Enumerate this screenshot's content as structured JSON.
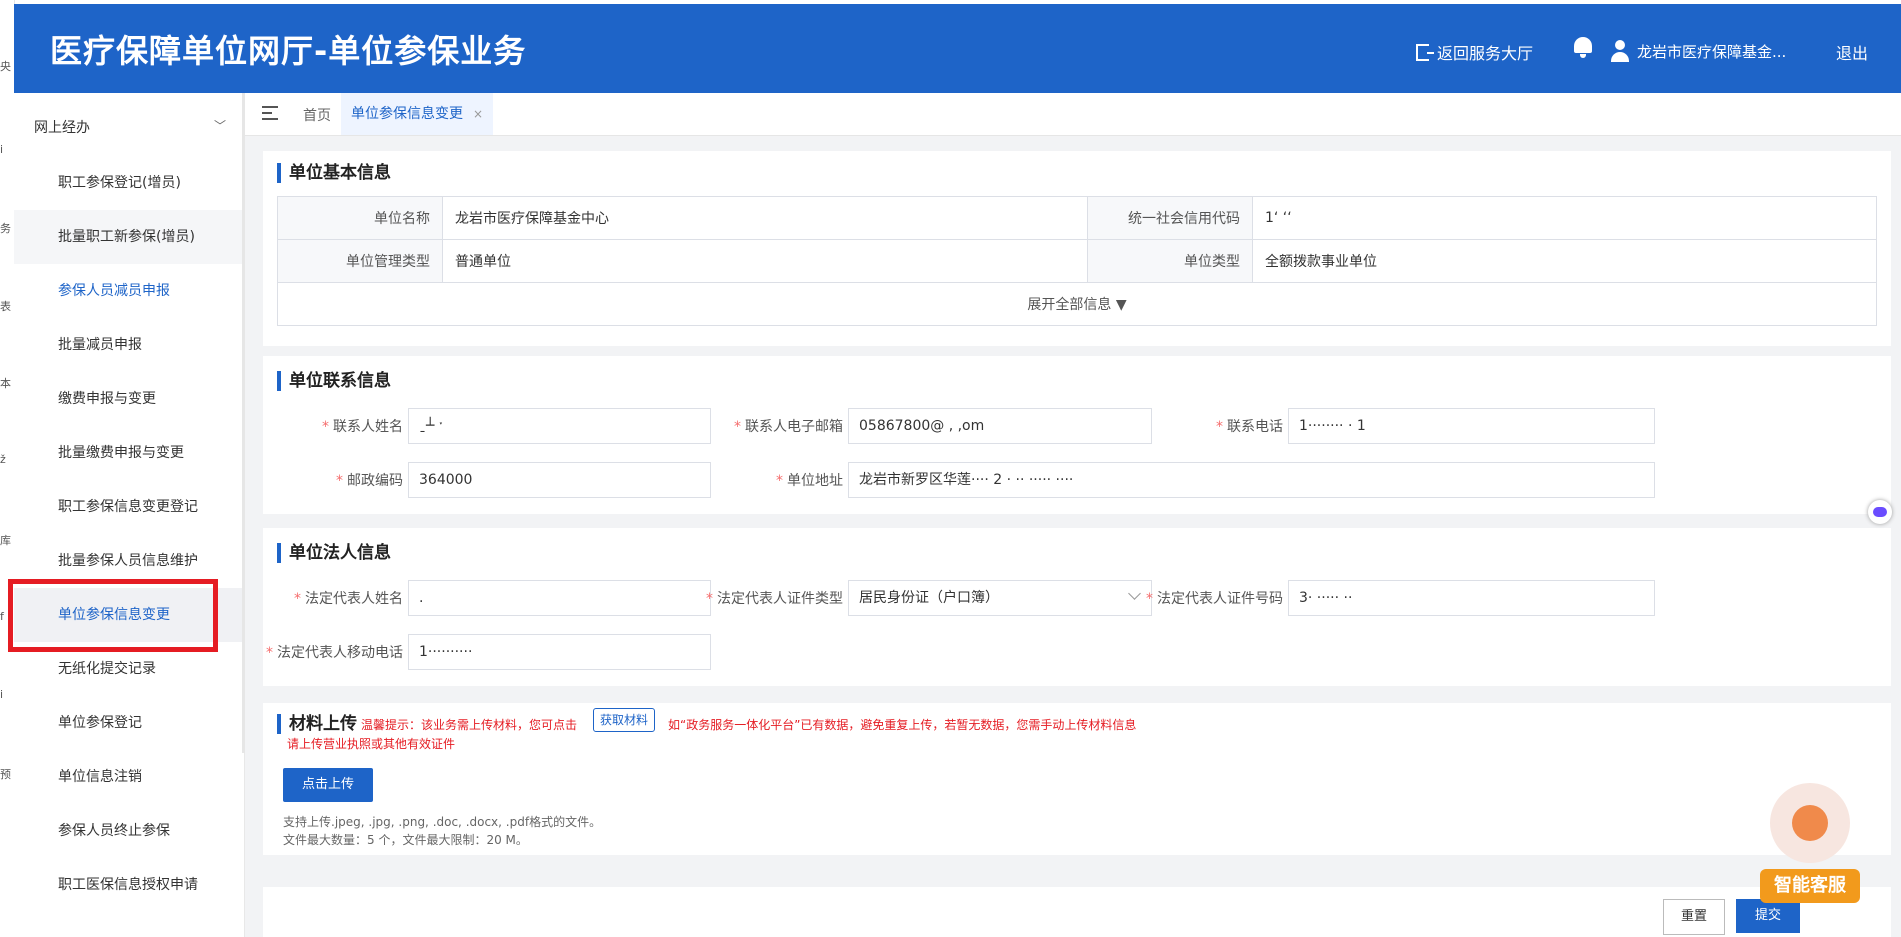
{
  "left_strip": [
    "央",
    "i",
    "务",
    "表",
    "本",
    "ž",
    "库",
    "f",
    "i",
    "预"
  ],
  "header": {
    "title": "医疗保障单位网厅-单位参保业务",
    "back_label": "返回服务大厅",
    "user_name": "龙岩市医疗保障基金...",
    "logout_label": "退出"
  },
  "sidebar": {
    "group_label": "网上经办",
    "items": [
      {
        "label": "职工参保登记(增员)"
      },
      {
        "label": "批量职工新参保(增员)"
      },
      {
        "label": "参保人员减员申报"
      },
      {
        "label": "批量减员申报"
      },
      {
        "label": "缴费申报与变更"
      },
      {
        "label": "批量缴费申报与变更"
      },
      {
        "label": "职工参保信息变更登记"
      },
      {
        "label": "批量参保人员信息维护"
      },
      {
        "label": "单位参保信息变更"
      },
      {
        "label": "无纸化提交记录"
      },
      {
        "label": "单位参保登记"
      },
      {
        "label": "单位信息注销"
      },
      {
        "label": "参保人员终止参保"
      },
      {
        "label": "职工医保信息授权申请"
      }
    ]
  },
  "tabs": {
    "home": "首页",
    "active": "单位参保信息变更",
    "close": "×"
  },
  "basic": {
    "title": "单位基本信息",
    "name_label": "单位名称",
    "name_value": "龙岩市医疗保障基金中心",
    "credit_label": "统一社会信用代码",
    "credit_value": "1‘                              ‘‘",
    "mgmt_label": "单位管理类型",
    "mgmt_value": "普通单位",
    "type_label": "单位类型",
    "type_value": "全额拨款事业单位",
    "expand_label": "展开全部信息 ▼"
  },
  "contact": {
    "title": "单位联系信息",
    "name_label": "联系人姓名",
    "name_value": "ˍ┴        ˑ",
    "email_label": "联系人电子邮箱",
    "email_value": "05867800@  ,  ,om",
    "phone_label": "联系电话",
    "phone_value": "1········  · 1",
    "zip_label": "邮政编码",
    "zip_value": "364000",
    "addr_label": "单位地址",
    "addr_value": "龙岩市新罗区华莲···· 2 ·    ·· ····· ····"
  },
  "legal": {
    "title": "单位法人信息",
    "name_label": "法定代表人姓名",
    "name_value": ".",
    "idtype_label": "法定代表人证件类型",
    "idtype_value": "居民身份证（户口簿）",
    "idno_label": "法定代表人证件号码",
    "idno_value": "3·                  ····· ··",
    "mobile_label": "法定代表人移动电话",
    "mobile_value": "1··········"
  },
  "upload": {
    "title": "材料上传",
    "tip_prefix": "温馨提示：该业务需上传材料，您可点击",
    "tip_button": "获取材料",
    "tip_suffix": "如“政务服务一体化平台”已有数据，避免重复上传，若暂无数据，您需手动上传材料信息",
    "req_hint": "请上传营业执照或其他有效证件",
    "button": "点击上传",
    "note1": "支持上传.jpeg, .jpg, .png, .doc, .docx, .pdf格式的文件。",
    "note2": "文件最大数量：5 个，文件最大限制：20 M。"
  },
  "actions": {
    "reset": "重置",
    "submit": "提交"
  },
  "assistant": {
    "label": "智能客服"
  }
}
